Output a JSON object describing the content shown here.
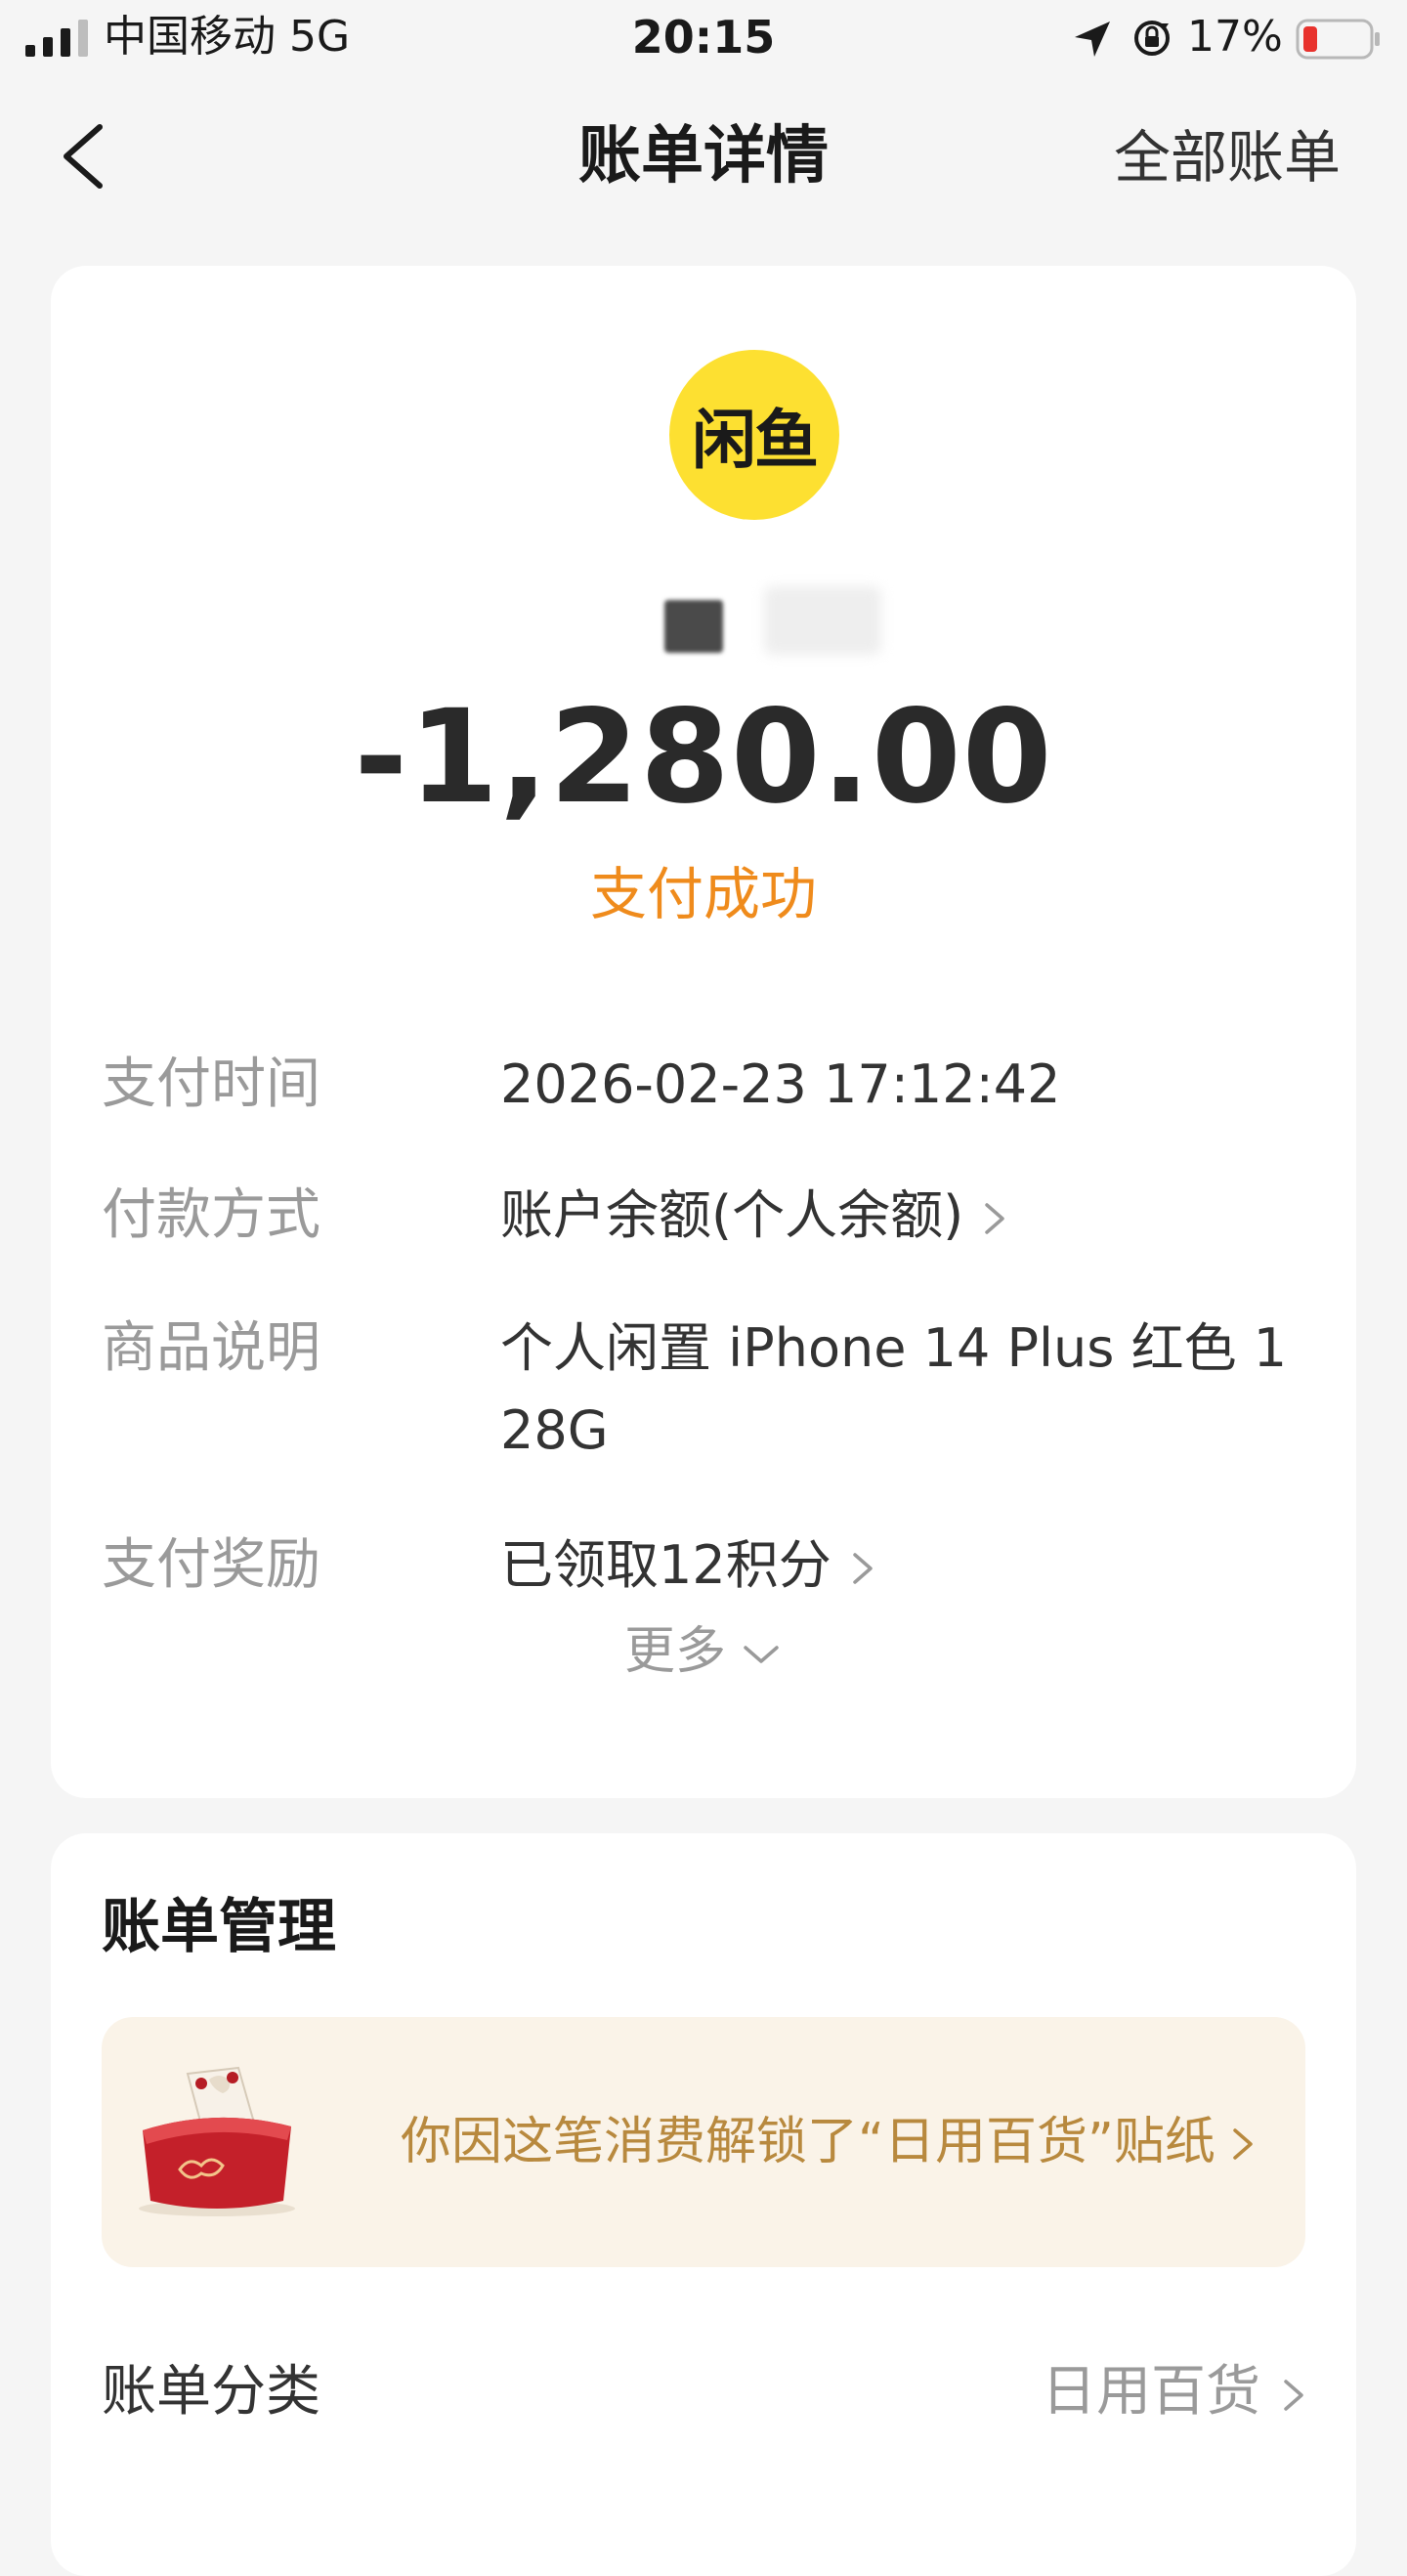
{
  "status_bar": {
    "carrier": "中国移动  5G",
    "time": "20:15",
    "battery": "17%"
  },
  "nav": {
    "title": "账单详情",
    "right_action": "全部账单"
  },
  "merchant": {
    "logo_text": "闲鱼"
  },
  "bill": {
    "amount": "-1,280.00",
    "status": "支付成功",
    "rows": [
      {
        "label": "支付时间",
        "value": "2026-02-23 17:12:42"
      },
      {
        "label": "付款方式",
        "value": "账户余额(个人余额)"
      },
      {
        "label": "商品说明",
        "value": "个人闲置 iPhone 14 Plus 红色 128G"
      },
      {
        "label": "支付奖励",
        "value": "已领取12积分"
      }
    ],
    "more_label": "更多"
  },
  "management": {
    "title": "账单管理",
    "sticker_text": "你因这笔消费解锁了“日用百货”贴纸",
    "category_label": "账单分类",
    "category_value": "日用百货"
  },
  "colors": {
    "accent_orange": "#ef8b1c",
    "logo_yellow": "#fde031",
    "sticker_text": "#b8893e",
    "sticker_bg": "#faf3e8"
  }
}
